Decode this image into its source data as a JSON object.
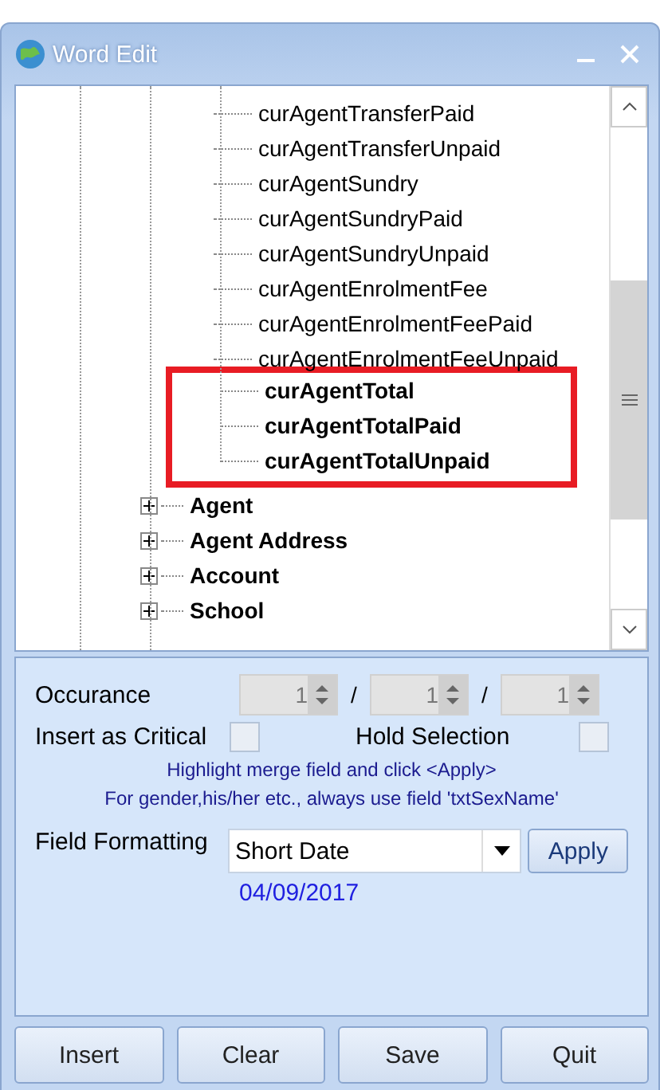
{
  "window": {
    "title": "Word Edit"
  },
  "tree": {
    "fields": [
      {
        "label": "curAgentTransferPaid",
        "highlighted": false
      },
      {
        "label": "curAgentTransferUnpaid",
        "highlighted": false
      },
      {
        "label": "curAgentSundry",
        "highlighted": false
      },
      {
        "label": "curAgentSundryPaid",
        "highlighted": false
      },
      {
        "label": "curAgentSundryUnpaid",
        "highlighted": false
      },
      {
        "label": "curAgentEnrolmentFee",
        "highlighted": false
      },
      {
        "label": "curAgentEnrolmentFeePaid",
        "highlighted": false
      },
      {
        "label": "curAgentEnrolmentFeeUnpaid",
        "highlighted": false
      },
      {
        "label": "curAgentTotal",
        "highlighted": true
      },
      {
        "label": "curAgentTotalPaid",
        "highlighted": true
      },
      {
        "label": "curAgentTotalUnpaid",
        "highlighted": true
      }
    ],
    "nodes": [
      {
        "label": "Agent",
        "expanded": false
      },
      {
        "label": "Agent Address",
        "expanded": false
      },
      {
        "label": "Account",
        "expanded": false
      },
      {
        "label": "School",
        "expanded": false
      }
    ]
  },
  "occurrence": {
    "label": "Occurance",
    "spinners": [
      "1",
      "1",
      "1"
    ],
    "separators": [
      "/",
      "/"
    ]
  },
  "checks": [
    {
      "label": "Insert as Critical",
      "checked": false
    },
    {
      "label": "Hold Selection",
      "checked": false
    }
  ],
  "hints": [
    "Highlight merge field and click <Apply>",
    "For gender,his/her etc., always use field 'txtSexName'"
  ],
  "formatting": {
    "label": "Field Formatting",
    "value": "Short Date",
    "button": "Apply",
    "preview": "04/09/2017"
  },
  "buttons": [
    "Insert",
    "Clear",
    "Save",
    "Quit"
  ]
}
